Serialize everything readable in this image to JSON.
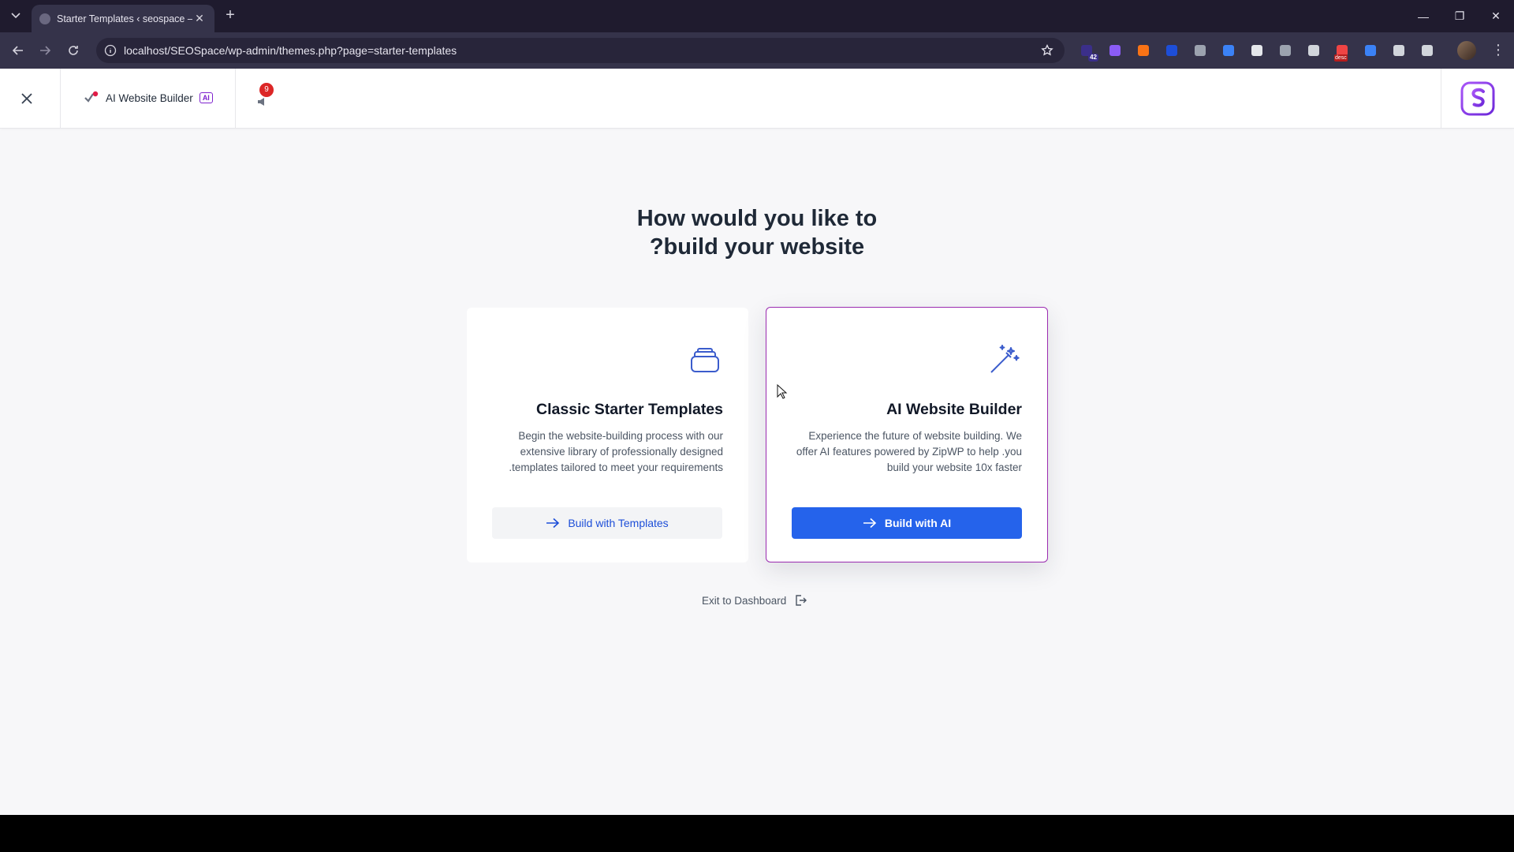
{
  "browser": {
    "tab_title": "Starter Templates ‹ seospace —",
    "url": "localhost/SEOSpace/wp-admin/themes.php?page=starter-templates",
    "extensions": [
      {
        "name": "extension-badge-42",
        "badge": "42",
        "color": "#3b2f8a"
      },
      {
        "name": "extension-gear",
        "color": "#8b5cf6"
      },
      {
        "name": "extension-flame",
        "color": "#f97316"
      },
      {
        "name": "extension-translate",
        "color": "#1d4ed8"
      },
      {
        "name": "extension-camera",
        "color": "#9ca3af"
      },
      {
        "name": "extension-stack",
        "color": "#3b82f6"
      },
      {
        "name": "extension-pen",
        "color": "#e5e7eb"
      },
      {
        "name": "extension-bracket",
        "color": "#9ca3af"
      },
      {
        "name": "extension-moon",
        "color": "#d1d5db"
      },
      {
        "name": "extension-desc",
        "label": "desc",
        "color": "#ef4444"
      },
      {
        "name": "extension-tag",
        "color": "#3b82f6"
      },
      {
        "name": "extension-shield",
        "color": "#d1d5db"
      },
      {
        "name": "extension-puzzle",
        "color": "#d1d5db"
      }
    ]
  },
  "header": {
    "builder_label": "AI Website Builder",
    "ai_badge": "AI",
    "notification_count": "9"
  },
  "main": {
    "heading_line1": "How would you like to",
    "heading_line2": "?build your website",
    "cards": [
      {
        "title": "Classic Starter Templates",
        "description": "Begin the website-building process with our extensive library of professionally designed .templates tailored to meet your requirements",
        "button": "Build with Templates"
      },
      {
        "title": "AI Website Builder",
        "description": "Experience the future of website building. We offer AI features powered by ZipWP to help .you build your website 10x faster",
        "button": "Build with AI"
      }
    ],
    "exit_label": "Exit to Dashboard"
  },
  "colors": {
    "accent_blue": "#2563eb",
    "accent_purple": "#7e22ce",
    "page_bg": "#f7f7f9"
  }
}
